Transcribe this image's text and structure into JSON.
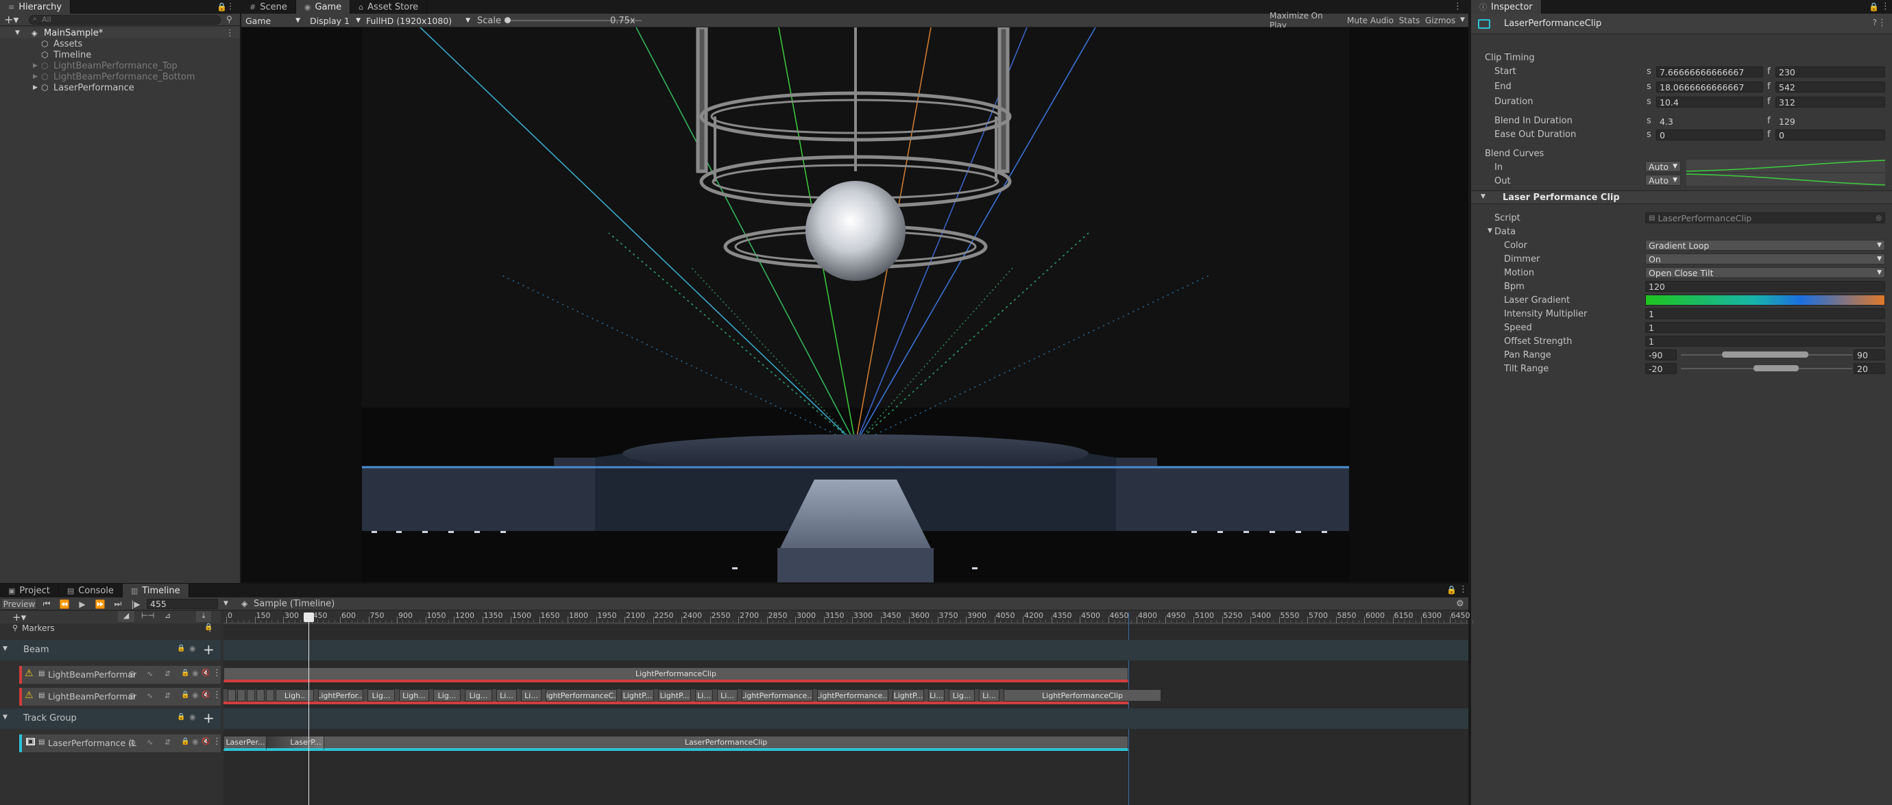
{
  "hierarchy": {
    "tab": "Hierarchy",
    "search_placeholder": "All",
    "scene": "MainSample*",
    "items": [
      {
        "label": "Assets",
        "dim": false
      },
      {
        "label": "Timeline",
        "dim": false
      },
      {
        "label": "LightBeamPerformance_Top",
        "dim": true
      },
      {
        "label": "LightBeamPerformance_Bottom",
        "dim": true
      },
      {
        "label": "LaserPerformance",
        "dim": false
      }
    ]
  },
  "center_tabs": [
    "Scene",
    "Game",
    "Asset Store"
  ],
  "game_toolbar": {
    "view": "Game",
    "display": "Display 1",
    "resolution": "FullHD (1920x1080)",
    "scale_label": "Scale",
    "scale_value": "0.75x",
    "buttons": [
      "Maximize On Play",
      "Mute Audio",
      "Stats",
      "Gizmos"
    ]
  },
  "bottom_tabs": [
    "Project",
    "Console",
    "Timeline"
  ],
  "timeline": {
    "preview_label": "Preview",
    "frame": "455",
    "asset": "Sample (Timeline)",
    "markers_label": "Markers",
    "ruler": [
      "0",
      "150",
      "300",
      "450",
      "600",
      "750",
      "900",
      "1050",
      "1200",
      "1350",
      "1500",
      "1650",
      "1800",
      "1950",
      "2100",
      "2250",
      "2400",
      "2550",
      "2700",
      "2850",
      "3000",
      "3150",
      "3300",
      "3450",
      "3600",
      "3750",
      "3900",
      "4050",
      "4200",
      "4350",
      "4500",
      "4650",
      "4800",
      "4950",
      "5100",
      "5250",
      "5400",
      "5550",
      "5700",
      "5850",
      "6000",
      "6150",
      "6300",
      "6450"
    ],
    "playhead_label": "455",
    "end_label": "4800",
    "group_beam": "Beam",
    "track_beam_1": "LightBeamPerformar",
    "track_beam_2": "LightBeamPerformar",
    "group_track": "Track Group",
    "track_laser": "LaserPerformance (L",
    "beam1_clip": "LightPerformanceClip",
    "beam2_clips": [
      "Ligh..",
      "LightPerfor...",
      "Lig...",
      "Ligh...",
      "Lig...",
      "Lig...",
      "Li...",
      "Li...",
      "LightPerformanceC...",
      "LightP...",
      "LightP...",
      "Li...",
      "Li...",
      "LightPerformance...",
      "LightPerformance...",
      "LightP...",
      "Li...",
      "Lig...",
      "Li...",
      "LightPerformanceClip"
    ],
    "laser_clips": [
      "LaserPer...",
      "LaserP...",
      "LaserPerformanceClip"
    ]
  },
  "inspector": {
    "tab": "Inspector",
    "title": "LaserPerformanceClip",
    "clip_timing": "Clip Timing",
    "start": {
      "label": "Start",
      "s": "7.66666666666667",
      "f": "230"
    },
    "end": {
      "label": "End",
      "s": "18.0666666666667",
      "f": "542"
    },
    "duration": {
      "label": "Duration",
      "s": "10.4",
      "f": "312"
    },
    "blend_in": {
      "label": "Blend In Duration",
      "s": "4.3",
      "f": "129"
    },
    "ease_out": {
      "label": "Ease Out Duration",
      "s": "0",
      "f": "0"
    },
    "unit_s": "s",
    "unit_f": "f",
    "blend_curves": "Blend Curves",
    "in_label": "In",
    "out_label": "Out",
    "auto": "Auto",
    "component": "Laser Performance Clip",
    "script_label": "Script",
    "script_value": "LaserPerformanceClip",
    "data_label": "Data",
    "color_label": "Color",
    "color_value": "Gradient Loop",
    "dimmer_label": "Dimmer",
    "dimmer_value": "On",
    "motion_label": "Motion",
    "motion_value": "Open Close Tilt",
    "bpm_label": "Bpm",
    "bpm_value": "120",
    "gradient_label": "Laser Gradient",
    "intensity_label": "Intensity Multiplier",
    "intensity_value": "1",
    "speed_label": "Speed",
    "speed_value": "1",
    "offset_label": "Offset Strength",
    "offset_value": "1",
    "pan_label": "Pan Range",
    "pan_min": "-90",
    "pan_max": "90",
    "tilt_label": "Tilt Range",
    "tilt_min": "-20",
    "tilt_max": "20"
  },
  "colors": {
    "accent": "#4c7fff",
    "red_track": "#d33d3d",
    "cyan_track": "#2cc3d6"
  }
}
